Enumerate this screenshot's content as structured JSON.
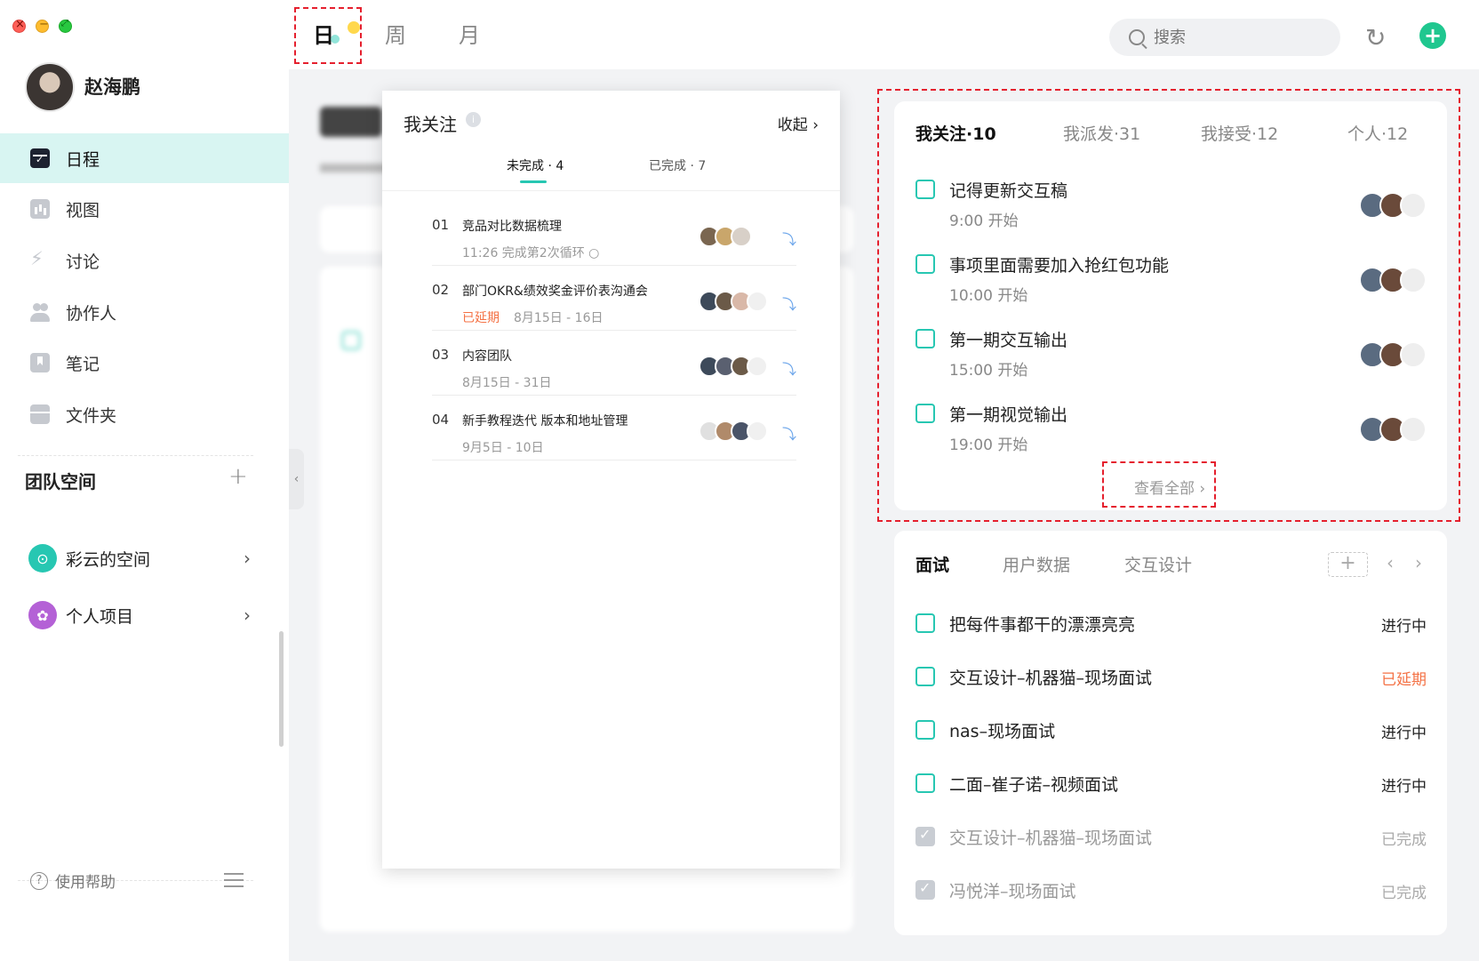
{
  "window": {
    "controls": [
      "close",
      "minimize",
      "fullscreen"
    ]
  },
  "user": {
    "name": "赵海鹏"
  },
  "sidebar": {
    "items": [
      {
        "label": "日程",
        "icon": "calendar-icon",
        "active": true
      },
      {
        "label": "视图",
        "icon": "chart-icon"
      },
      {
        "label": "讨论",
        "icon": "discussion-icon"
      },
      {
        "label": "协作人",
        "icon": "people-icon"
      },
      {
        "label": "笔记",
        "icon": "bookmark-icon"
      },
      {
        "label": "文件夹",
        "icon": "folder-icon"
      }
    ],
    "team_title": "团队空间",
    "spaces": [
      {
        "label": "彩云的空间",
        "color": "#27c7b2"
      },
      {
        "label": "个人项目",
        "color": "#b461d6"
      }
    ],
    "help": "使用帮助"
  },
  "topbar": {
    "tabs": [
      "日",
      "周",
      "月"
    ],
    "active_tab": "日",
    "search_placeholder": "搜索"
  },
  "popup": {
    "title": "我关注",
    "collapse": "收起",
    "tabs": [
      "未完成 · 4",
      "已完成 · 7"
    ],
    "rows": [
      {
        "num": "01",
        "title": "竞品对比数据梳理",
        "late": "",
        "sub": "11:26 完成第2次循环 ○"
      },
      {
        "num": "02",
        "title": "部门OKR&绩效奖金评价表沟通会",
        "late": "已延期",
        "sub": "8月15日 - 16日"
      },
      {
        "num": "03",
        "title": "内容团队",
        "late": "",
        "sub": "8月15日 - 31日"
      },
      {
        "num": "04",
        "title": "新手教程迭代 版本和地址管理",
        "late": "",
        "sub": "9月5日 - 10日"
      }
    ]
  },
  "follow": {
    "tabs": [
      "我关注·10",
      "我派发·31",
      "我接受·12",
      "个人·12"
    ],
    "rows": [
      {
        "title": "记得更新交互稿",
        "time": "9:00 开始"
      },
      {
        "title": "事项里面需要加入抢红包功能",
        "time": "10:00 开始"
      },
      {
        "title": "第一期交互输出",
        "time": "15:00 开始"
      },
      {
        "title": "第一期视觉输出",
        "time": "19:00 开始"
      }
    ],
    "view_all": "查看全部 ›"
  },
  "project": {
    "tabs": [
      "面试",
      "用户数据",
      "交互设计"
    ],
    "add": "+",
    "rows": [
      {
        "title": "把每件事都干的漂漂亮亮",
        "status": "进行中",
        "state": "open"
      },
      {
        "title": "交互设计–机器猫–现场面试",
        "status": "已延期",
        "state": "late"
      },
      {
        "title": "nas–现场面试",
        "status": "进行中",
        "state": "open"
      },
      {
        "title": "二面–崔子诺–视频面试",
        "status": "进行中",
        "state": "open"
      },
      {
        "title": "交互设计–机器猫–现场面试",
        "status": "已完成",
        "state": "done"
      },
      {
        "title": "冯悦洋–现场面试",
        "status": "已完成",
        "state": "done"
      }
    ]
  },
  "colors": {
    "accent": "#27c7b2",
    "late": "#f47144",
    "add": "#1fc78f"
  }
}
